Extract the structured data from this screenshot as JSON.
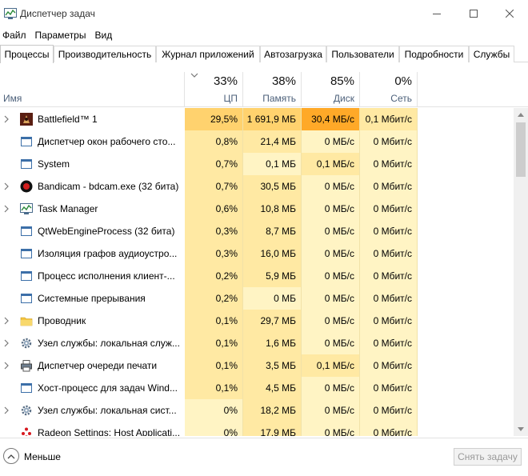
{
  "window": {
    "title": "Диспетчер задач"
  },
  "menu": [
    "Файл",
    "Параметры",
    "Вид"
  ],
  "tabs": [
    "Процессы",
    "Производительность",
    "Журнал приложений",
    "Автозагрузка",
    "Пользователи",
    "Подробности",
    "Службы"
  ],
  "active_tab": "Процессы",
  "columns": {
    "name": "Имя",
    "cpu": {
      "percent": "33%",
      "label": "ЦП"
    },
    "memory": {
      "percent": "38%",
      "label": "Память"
    },
    "disk": {
      "percent": "85%",
      "label": "Диск"
    },
    "network": {
      "percent": "0%",
      "label": "Сеть"
    }
  },
  "colors": {
    "cell_light": "#fff4c4",
    "cell_mid": "#ffe9a3",
    "cell_hot": "#ffd26e",
    "cell_hottest": "#ffa928"
  },
  "processes": [
    {
      "name": "Battlefield™ 1",
      "expandable": true,
      "icon": "battlefield-icon",
      "cpu": "29,5%",
      "memory": "1 691,9 МБ",
      "disk": "30,4 МБ/с",
      "network": "0,1 Мбит/с"
    },
    {
      "name": "Диспетчер окон рабочего сто...",
      "expandable": false,
      "icon": "window-icon",
      "cpu": "0,8%",
      "memory": "21,4 МБ",
      "disk": "0 МБ/с",
      "network": "0 Мбит/с"
    },
    {
      "name": "System",
      "expandable": false,
      "icon": "window-icon",
      "cpu": "0,7%",
      "memory": "0,1 МБ",
      "disk": "0,1 МБ/с",
      "network": "0 Мбит/с"
    },
    {
      "name": "Bandicam - bdcam.exe (32 бита)",
      "expandable": true,
      "icon": "bandicam-icon",
      "cpu": "0,7%",
      "memory": "30,5 МБ",
      "disk": "0 МБ/с",
      "network": "0 Мбит/с"
    },
    {
      "name": "Task Manager",
      "expandable": true,
      "icon": "task-manager-icon",
      "cpu": "0,6%",
      "memory": "10,8 МБ",
      "disk": "0 МБ/с",
      "network": "0 Мбит/с"
    },
    {
      "name": "QtWebEngineProcess (32 бита)",
      "expandable": false,
      "icon": "window-icon",
      "cpu": "0,3%",
      "memory": "8,7 МБ",
      "disk": "0 МБ/с",
      "network": "0 Мбит/с"
    },
    {
      "name": "Изоляция графов аудиоустро...",
      "expandable": false,
      "icon": "window-icon",
      "cpu": "0,3%",
      "memory": "16,0 МБ",
      "disk": "0 МБ/с",
      "network": "0 Мбит/с"
    },
    {
      "name": "Процесс исполнения клиент-...",
      "expandable": false,
      "icon": "window-icon",
      "cpu": "0,2%",
      "memory": "5,9 МБ",
      "disk": "0 МБ/с",
      "network": "0 Мбит/с"
    },
    {
      "name": "Системные прерывания",
      "expandable": false,
      "icon": "window-icon",
      "cpu": "0,2%",
      "memory": "0 МБ",
      "disk": "0 МБ/с",
      "network": "0 Мбит/с"
    },
    {
      "name": "Проводник",
      "expandable": true,
      "icon": "folder-icon",
      "cpu": "0,1%",
      "memory": "29,7 МБ",
      "disk": "0 МБ/с",
      "network": "0 Мбит/с"
    },
    {
      "name": "Узел службы: локальная служ...",
      "expandable": true,
      "icon": "gear-icon",
      "cpu": "0,1%",
      "memory": "1,6 МБ",
      "disk": "0 МБ/с",
      "network": "0 Мбит/с"
    },
    {
      "name": "Диспетчер очереди печати",
      "expandable": true,
      "icon": "printer-icon",
      "cpu": "0,1%",
      "memory": "3,5 МБ",
      "disk": "0,1 МБ/с",
      "network": "0 Мбит/с"
    },
    {
      "name": "Хост-процесс для задач Wind...",
      "expandable": false,
      "icon": "window-icon",
      "cpu": "0,1%",
      "memory": "4,5 МБ",
      "disk": "0 МБ/с",
      "network": "0 Мбит/с"
    },
    {
      "name": "Узел службы: локальная сист...",
      "expandable": true,
      "icon": "gear-icon",
      "cpu": "0%",
      "memory": "18,2 МБ",
      "disk": "0 МБ/с",
      "network": "0 Мбит/с"
    },
    {
      "name": "Radeon Settings: Host Applicati...",
      "expandable": false,
      "icon": "radeon-icon",
      "cpu": "0%",
      "memory": "17,9 МБ",
      "disk": "0 МБ/с",
      "network": "0 Мбит/с"
    }
  ],
  "footer": {
    "less_label": "Меньше",
    "end_task_label": "Снять задачу"
  }
}
